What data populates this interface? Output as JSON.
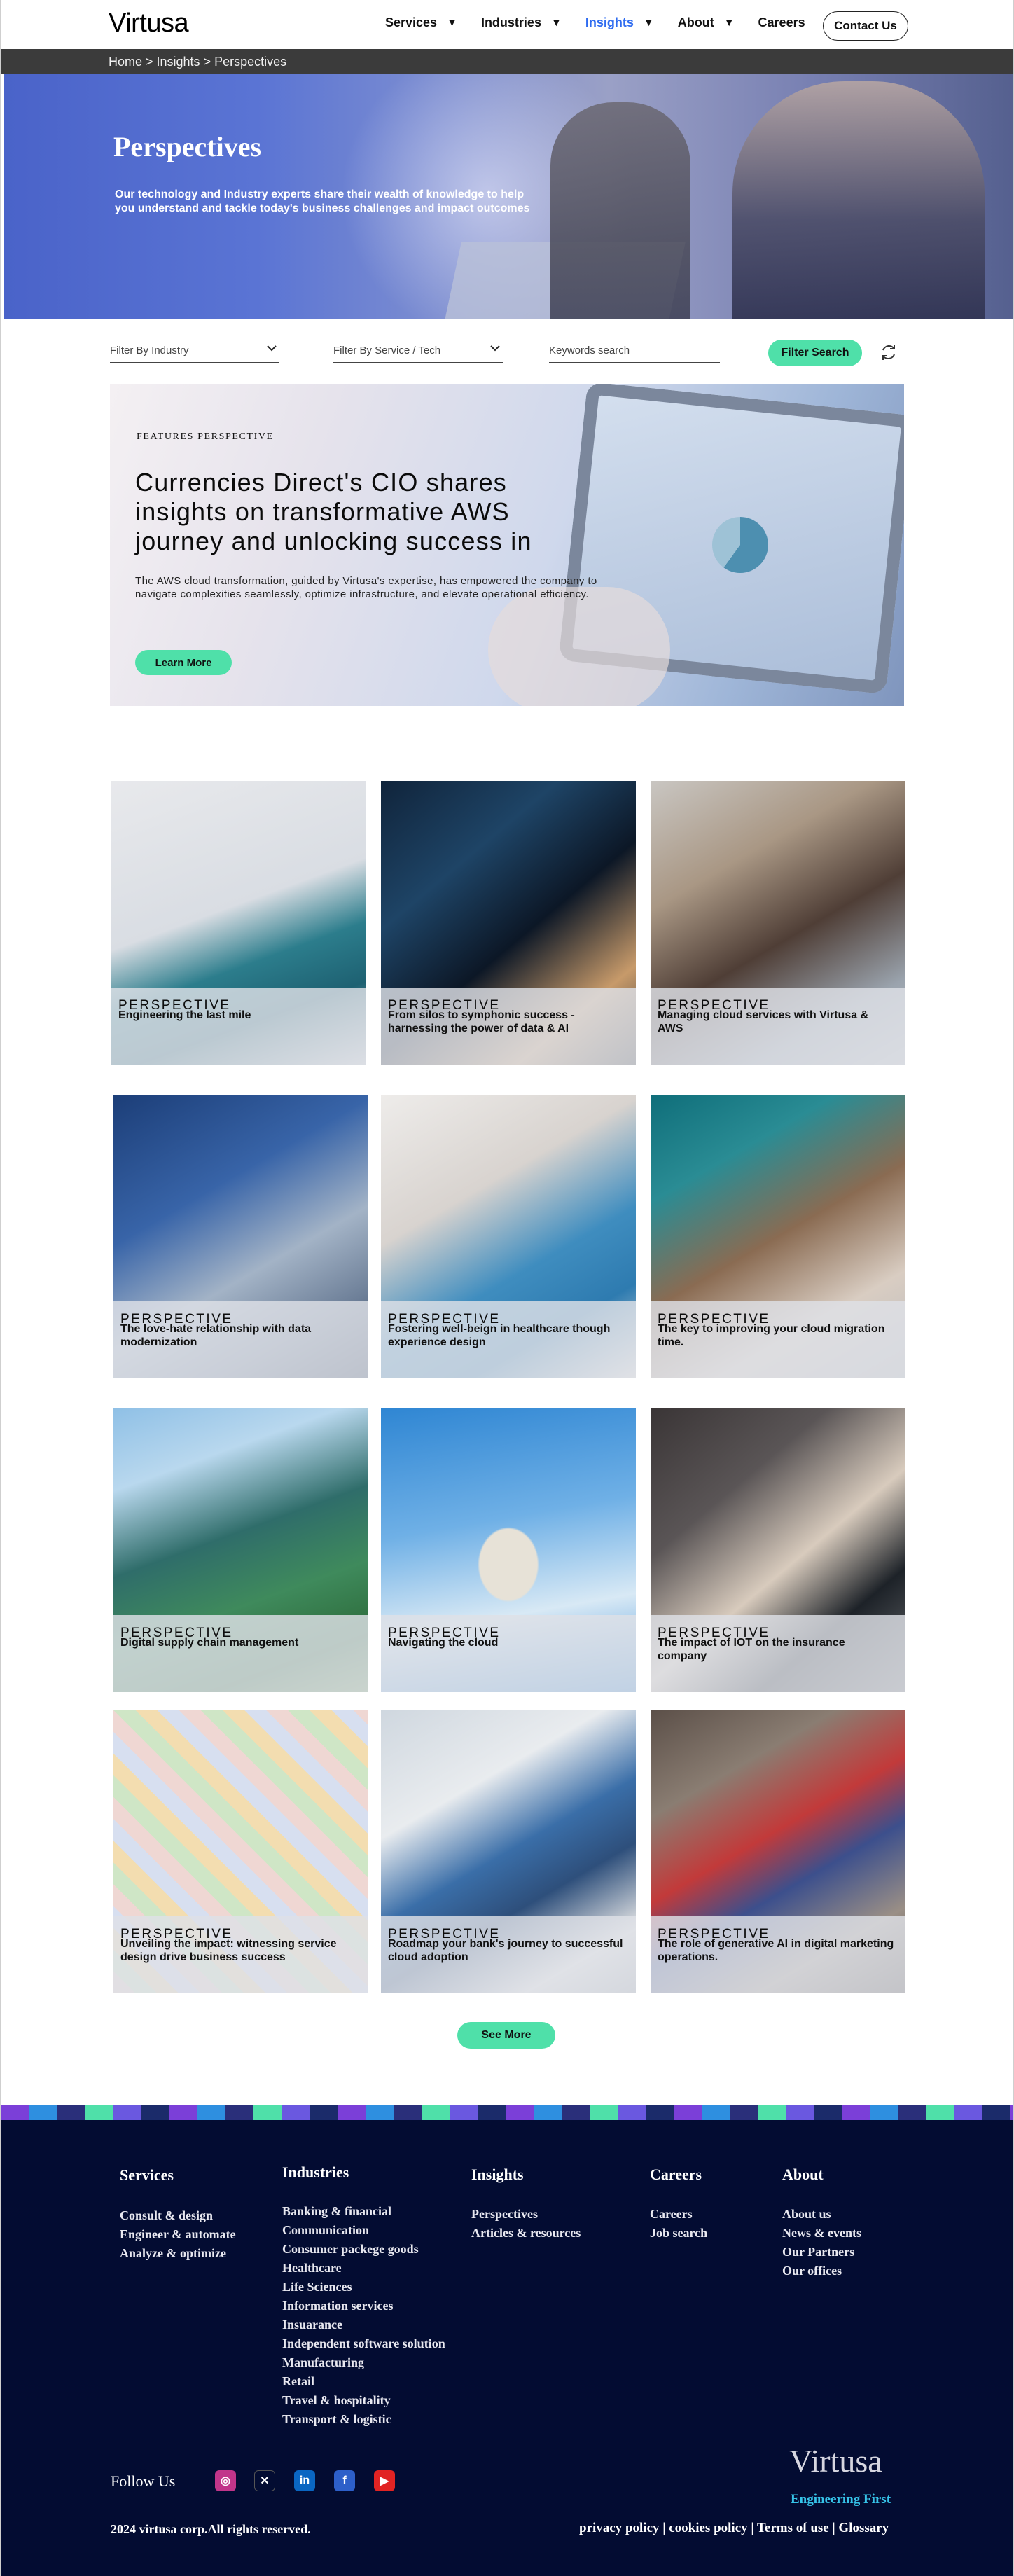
{
  "header": {
    "logo": "Virtusa",
    "menu": [
      {
        "label": "Services",
        "caret": "▼"
      },
      {
        "label": "Industries",
        "caret": "▼"
      },
      {
        "label": "Insights",
        "caret": "▼"
      },
      {
        "label": "About",
        "caret": "▼"
      },
      {
        "label": "Careers",
        "caret": ""
      }
    ],
    "active_menu": "Insights",
    "contact_label": "Contact Us"
  },
  "breadcrumb": "Home > Insights > Perspectives",
  "hero": {
    "title": "Perspectives",
    "subtitle": "Our technology and Industry experts share their wealth of knowledge to help you understand and tackle today's business challenges and impact outcomes"
  },
  "filters": {
    "industry_label": "Filter By Industry",
    "service_label": "Filter By Service / Tech",
    "search_placeholder": "Keywords search",
    "search_button": "Filter Search",
    "refresh_icon": "refresh-icon"
  },
  "feature": {
    "kicker": "FEATURES PERSPECTIVE",
    "title": "Currencies Direct's CIO shares insights on transformative AWS journey and unlocking success in",
    "description": "The AWS cloud transformation, guided by Virtusa's expertise, has empowered the company to navigate complexities seamlessly, optimize infrastructure, and elevate operational efficiency.",
    "button": "Learn More"
  },
  "cards": [
    {
      "kicker": "PERSPECTIVE",
      "title": "Engineering the last mile"
    },
    {
      "kicker": "PERSPECTIVE",
      "title": "From silos to symphonic success - harnessing the power of data & AI"
    },
    {
      "kicker": "PERSPECTIVE",
      "title": "Managing cloud services with Virtusa & AWS"
    },
    {
      "kicker": "PERSPECTIVE",
      "title": "The love-hate relationship with data modernization"
    },
    {
      "kicker": "PERSPECTIVE",
      "title": "Fostering well-beign in healthcare though experience design"
    },
    {
      "kicker": "PERSPECTIVE",
      "title": "The key to improving your cloud migration time."
    },
    {
      "kicker": "PERSPECTIVE",
      "title": "Digital supply chain management"
    },
    {
      "kicker": "PERSPECTIVE",
      "title": "Navigating the cloud"
    },
    {
      "kicker": "PERSPECTIVE",
      "title": "The impact of IOT on the insurance company"
    },
    {
      "kicker": "PERSPECTIVE",
      "title": "Unveiling the impact: witnessing service design drive business success"
    },
    {
      "kicker": "PERSPECTIVE",
      "title": "Roadmap your bank's journey to successful cloud adoption"
    },
    {
      "kicker": "PERSPECTIVE",
      "title": "The role of generative AI in digital marketing operations."
    }
  ],
  "see_more": "See More",
  "footer": {
    "columns": [
      {
        "title": "Services",
        "items": [
          "Consult & design",
          "Engineer & automate",
          "Analyze & optimize"
        ]
      },
      {
        "title": "Industries",
        "items": [
          "Banking & financial",
          "Communication",
          "Consumer packege goods",
          "Healthcare",
          "Life Sciences",
          "Information services",
          "Insuarance",
          "Independent software solution",
          "Manufacturing",
          "Retail",
          "Travel & hospitality",
          "Transport & logistic"
        ]
      },
      {
        "title": "Insights",
        "items": [
          "Perspectives",
          "Articles & resources"
        ]
      },
      {
        "title": "Careers",
        "items": [
          "Careers",
          "Job search"
        ]
      },
      {
        "title": "About",
        "items": [
          "About us",
          "News & events",
          "Our Partners",
          "Our offices"
        ]
      }
    ],
    "follow_label": "Follow Us",
    "social": [
      {
        "name": "instagram-icon",
        "glyph": "◎",
        "color": "#c1358a"
      },
      {
        "name": "x-icon",
        "glyph": "✕",
        "color": "#030c32"
      },
      {
        "name": "linkedin-icon",
        "glyph": "in",
        "color": "#0a66c2"
      },
      {
        "name": "facebook-icon",
        "glyph": "f",
        "color": "#2d5fc9"
      },
      {
        "name": "youtube-icon",
        "glyph": "▶",
        "color": "#e12323"
      }
    ],
    "logo": "Virtusa",
    "tagline": "Engineering First",
    "copyright": "2024 virtusa corp.All rights reserved.",
    "links": [
      "privacy policy",
      "cookies policy",
      "Terms of use",
      "Glossary"
    ],
    "link_separator": " | "
  },
  "colors": {
    "accent": "#4fe0a9",
    "active_nav": "#2f6cf0",
    "footer_bg": "#030c32",
    "tagline": "#36c3e8"
  }
}
